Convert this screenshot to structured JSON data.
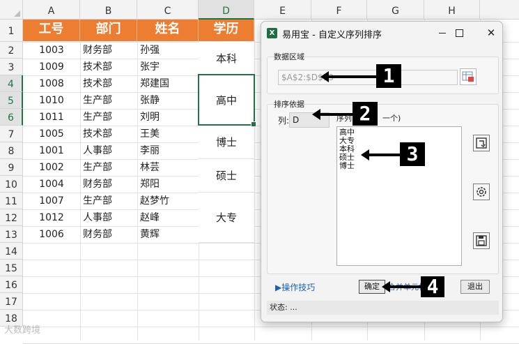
{
  "spreadsheet": {
    "columns": [
      "A",
      "B",
      "C",
      "D",
      "E",
      "F",
      "G",
      "H"
    ],
    "selected_column": "D",
    "rows": [
      "1",
      "2",
      "3",
      "4",
      "5",
      "6",
      "7",
      "8",
      "9",
      "10",
      "11",
      "12",
      "13",
      "14",
      "15",
      "16",
      "17",
      "18"
    ],
    "selected_rows": [
      "4",
      "5",
      "6"
    ],
    "headers": [
      "工号",
      "部门",
      "姓名",
      "学历"
    ],
    "header_color": "#ed7d31",
    "data": [
      [
        "1003",
        "财务部",
        "孙强"
      ],
      [
        "1009",
        "技术部",
        "张宇"
      ],
      [
        "1008",
        "技术部",
        "郑建国"
      ],
      [
        "1010",
        "生产部",
        "张静"
      ],
      [
        "1011",
        "生产部",
        "刘明"
      ],
      [
        "1005",
        "技术部",
        "王美"
      ],
      [
        "1001",
        "人事部",
        "李丽"
      ],
      [
        "1002",
        "生产部",
        "林芸"
      ],
      [
        "1004",
        "财务部",
        "郑阳"
      ],
      [
        "1007",
        "生产部",
        "赵梦竹"
      ],
      [
        "1012",
        "人事部",
        "赵峰"
      ],
      [
        "1006",
        "财务部",
        "黄辉"
      ]
    ],
    "education_merged": [
      "本科",
      "高中",
      "博士",
      "硕士",
      "大专"
    ],
    "watermark": "大数跨境"
  },
  "dialog": {
    "app_icon": "X",
    "title": "易用宝 - 自定义序列排序",
    "data_area_label": "数据区域",
    "range_value": "$A$2:$D$13",
    "sort_basis_label": "排序依据",
    "column_label": "列:",
    "column_value": "D",
    "sequence_label": "序列",
    "sequence_label_tail": "一个)",
    "sequence_items": [
      "高中",
      "大专",
      "本科",
      "硕士",
      "博士"
    ],
    "tips_link": "▶操作技巧",
    "ok_label": "确定",
    "ok_side_link": "合并单元格",
    "exit_label": "退出",
    "status_text": "状态: ..."
  },
  "annotations": {
    "badges": [
      "1",
      "2",
      "3",
      "4"
    ]
  }
}
